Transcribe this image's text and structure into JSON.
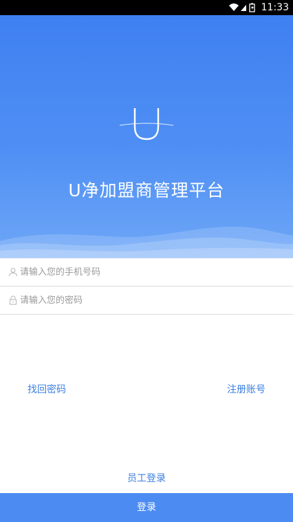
{
  "status_bar": {
    "time": "11:33",
    "icons": [
      "wifi-icon",
      "signal-icon",
      "battery-icon"
    ]
  },
  "header": {
    "logo_icon": "u-logo-icon",
    "title": "U净加盟商管理平台"
  },
  "form": {
    "phone": {
      "placeholder": "请输入您的手机号码",
      "value": "",
      "icon": "user-icon"
    },
    "password": {
      "placeholder": "请输入您的密码",
      "value": "",
      "icon": "lock-icon"
    }
  },
  "links": {
    "forgot_password": "找回密码",
    "register": "注册账号",
    "staff_login": "员工登录"
  },
  "login_button": "登录",
  "colors": {
    "primary": "#4c8cf2",
    "link": "#3b7fe0",
    "hero_top": "#3f80f1",
    "hero_bottom": "#6ea7f7"
  }
}
